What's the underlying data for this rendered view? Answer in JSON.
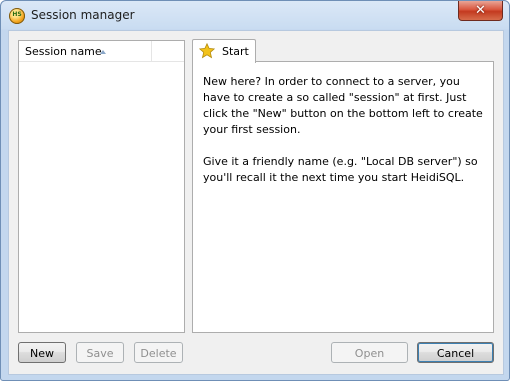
{
  "window": {
    "title": "Session manager",
    "close_symbol": "✕"
  },
  "app_icon": {
    "text": "HS"
  },
  "session_list": {
    "column_header": "Session name",
    "sort_direction": "ascending",
    "items": []
  },
  "tabs": [
    {
      "label": "Start",
      "icon": "star-icon",
      "selected": true
    }
  ],
  "start_panel": {
    "paragraphs": [
      "New here? In order to connect to a server, you have to create a so called \"session\" at first. Just click the \"New\" button on the bottom left to create your first session.",
      "Give it a friendly name (e.g. \"Local DB server\") so you'll recall it the next time you start HeidiSQL."
    ]
  },
  "buttons": {
    "new": {
      "label": "New",
      "enabled": true
    },
    "save": {
      "label": "Save",
      "enabled": false
    },
    "delete": {
      "label": "Delete",
      "enabled": false
    },
    "open": {
      "label": "Open",
      "enabled": false
    },
    "cancel": {
      "label": "Cancel",
      "enabled": true
    }
  },
  "colors": {
    "close_button": "#c9452a",
    "star": "#f2c21a"
  }
}
